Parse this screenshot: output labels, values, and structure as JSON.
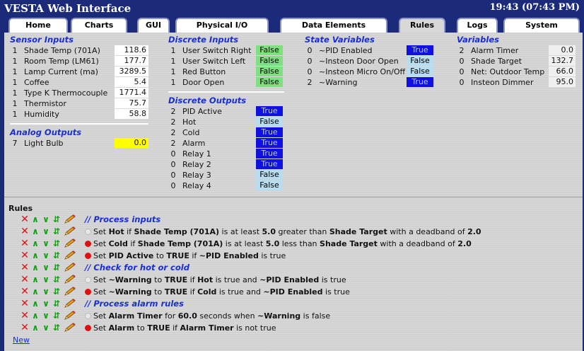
{
  "header": {
    "title": "VESTA Web Interface",
    "clock": "19:43 (07:43 PM)"
  },
  "tabs": [
    "Home",
    "Charts",
    "GUI",
    "Physical I/O",
    "Data Elements",
    "Rules",
    "Logs",
    "System"
  ],
  "sensor_inputs": {
    "title": "Sensor Inputs",
    "items": [
      {
        "num": "1",
        "label": "Shade Temp (701A)",
        "value": "118.6"
      },
      {
        "num": "1",
        "label": "Room Temp (LM61)",
        "value": "177.7"
      },
      {
        "num": "1",
        "label": "Lamp Current (ma)",
        "value": "3289.5"
      },
      {
        "num": "1",
        "label": "Coffee",
        "value": "5.4"
      },
      {
        "num": "1",
        "label": "Type K Thermocouple",
        "value": "1771.4"
      },
      {
        "num": "1",
        "label": "Thermistor",
        "value": "75.7"
      },
      {
        "num": "1",
        "label": "Humidity",
        "value": "58.8"
      }
    ]
  },
  "analog_outputs": {
    "title": "Analog Outputs",
    "items": [
      {
        "num": "7",
        "label": "Light Bulb",
        "value": "0.0"
      }
    ]
  },
  "discrete_inputs": {
    "title": "Discrete Inputs",
    "items": [
      {
        "num": "1",
        "label": "User Switch Right",
        "state": "False"
      },
      {
        "num": "1",
        "label": "User Switch Left",
        "state": "False"
      },
      {
        "num": "1",
        "label": "Red Button",
        "state": "False"
      },
      {
        "num": "1",
        "label": "Door Open",
        "state": "False"
      }
    ]
  },
  "discrete_outputs": {
    "title": "Discrete Outputs",
    "items": [
      {
        "num": "2",
        "label": "PID Active",
        "state": "True"
      },
      {
        "num": "2",
        "label": "Hot",
        "state": "False"
      },
      {
        "num": "2",
        "label": "Cold",
        "state": "True"
      },
      {
        "num": "2",
        "label": "Alarm",
        "state": "True"
      },
      {
        "num": "0",
        "label": "Relay 1",
        "state": "True"
      },
      {
        "num": "0",
        "label": "Relay 2",
        "state": "True"
      },
      {
        "num": "0",
        "label": "Relay 3",
        "state": "False"
      },
      {
        "num": "0",
        "label": "Relay 4",
        "state": "False"
      }
    ]
  },
  "state_variables": {
    "title": "State Variables",
    "items": [
      {
        "num": "0",
        "label": "~PID Enabled",
        "state": "True"
      },
      {
        "num": "0",
        "label": "~Insteon Door Open",
        "state": "False"
      },
      {
        "num": "0",
        "label": "~Insteon Micro On/Off",
        "state": "False"
      },
      {
        "num": "2",
        "label": "~Warning",
        "state": "True"
      }
    ]
  },
  "variables": {
    "title": "Variables",
    "items": [
      {
        "num": "2",
        "label": "Alarm Timer",
        "value": "0.0"
      },
      {
        "num": "0",
        "label": "Shade Target",
        "value": "132.7"
      },
      {
        "num": "0",
        "label": "Net: Outdoor Temp",
        "value": "66.0"
      },
      {
        "num": "0",
        "label": "Insteon Dimmer",
        "value": "95.0"
      }
    ]
  },
  "rules": {
    "heading": "Rules",
    "new_link": "New",
    "items": [
      {
        "type": "comment",
        "text": "// Process inputs"
      },
      {
        "type": "rule",
        "dot": "grey",
        "parts": [
          [
            "Set ",
            0
          ],
          [
            "Hot",
            1
          ],
          [
            " if ",
            0
          ],
          [
            "Shade Temp (701A)",
            1
          ],
          [
            " is at least ",
            0
          ],
          [
            "5.0",
            1
          ],
          [
            " greater than ",
            0
          ],
          [
            "Shade Target",
            1
          ],
          [
            " with a deadband of ",
            0
          ],
          [
            "2.0",
            1
          ]
        ]
      },
      {
        "type": "rule",
        "dot": "red",
        "parts": [
          [
            "Set ",
            0
          ],
          [
            "Cold",
            1
          ],
          [
            " if ",
            0
          ],
          [
            "Shade Temp (701A)",
            1
          ],
          [
            " is at least ",
            0
          ],
          [
            "5.0",
            1
          ],
          [
            " less than ",
            0
          ],
          [
            "Shade Target",
            1
          ],
          [
            " with a deadband of ",
            0
          ],
          [
            "2.0",
            1
          ]
        ]
      },
      {
        "type": "rule",
        "dot": "red",
        "parts": [
          [
            "Set ",
            0
          ],
          [
            "PID Active",
            1
          ],
          [
            " to ",
            0
          ],
          [
            "TRUE",
            1
          ],
          [
            " if ",
            0
          ],
          [
            "~PID Enabled",
            1
          ],
          [
            " is true",
            0
          ]
        ]
      },
      {
        "type": "comment",
        "text": "// Check for hot or cold"
      },
      {
        "type": "rule",
        "dot": "grey",
        "parts": [
          [
            "Set ",
            0
          ],
          [
            "~Warning",
            1
          ],
          [
            " to ",
            0
          ],
          [
            "TRUE",
            1
          ],
          [
            " if ",
            0
          ],
          [
            "Hot",
            1
          ],
          [
            " is true and ",
            0
          ],
          [
            "~PID Enabled",
            1
          ],
          [
            " is true",
            0
          ]
        ]
      },
      {
        "type": "rule",
        "dot": "red",
        "parts": [
          [
            "Set ",
            0
          ],
          [
            "~Warning",
            1
          ],
          [
            " to ",
            0
          ],
          [
            "TRUE",
            1
          ],
          [
            " if ",
            0
          ],
          [
            "Cold",
            1
          ],
          [
            " is true and ",
            0
          ],
          [
            "~PID Enabled",
            1
          ],
          [
            " is true",
            0
          ]
        ]
      },
      {
        "type": "comment",
        "text": "// Process alarm rules"
      },
      {
        "type": "rule",
        "dot": "grey",
        "parts": [
          [
            "Set ",
            0
          ],
          [
            "Alarm Timer",
            1
          ],
          [
            " for ",
            0
          ],
          [
            "60.0",
            1
          ],
          [
            " seconds when ",
            0
          ],
          [
            "~Warning",
            1
          ],
          [
            " is false",
            0
          ]
        ]
      },
      {
        "type": "rule",
        "dot": "red",
        "parts": [
          [
            "Set ",
            0
          ],
          [
            "Alarm",
            1
          ],
          [
            " to ",
            0
          ],
          [
            "TRUE",
            1
          ],
          [
            " if ",
            0
          ],
          [
            "Alarm Timer",
            1
          ],
          [
            " is not true",
            0
          ]
        ]
      }
    ]
  },
  "colors": {
    "accent": "#1a2fd0",
    "header_bg": "#1b2b7a",
    "panel_bg": "#d4d4d4",
    "true_bg": "#1010e0",
    "false_green": "#80e080",
    "false_blue": "#b8dcf0",
    "highlight_yellow": "#ffff00"
  },
  "icons": {
    "delete": "delete-icon",
    "up": "move-up-icon",
    "down": "move-down-icon",
    "move": "move-icon",
    "edit": "edit-pencil-icon"
  }
}
